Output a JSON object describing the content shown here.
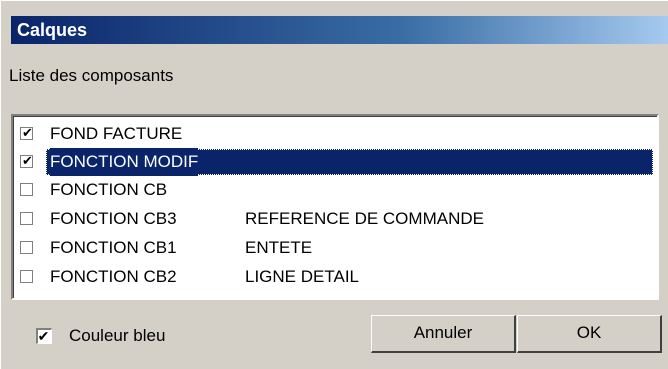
{
  "dialog": {
    "title": "Calques",
    "list_label": "Liste des composants"
  },
  "items": [
    {
      "checked": true,
      "label": "FOND FACTURE",
      "sub": ""
    },
    {
      "checked": true,
      "label": "FONCTION MODIF",
      "sub": "",
      "selected": true
    },
    {
      "checked": false,
      "label": "FONCTION CB",
      "sub": ""
    },
    {
      "checked": false,
      "label": "FONCTION CB3",
      "sub": "REFERENCE DE COMMANDE"
    },
    {
      "checked": false,
      "label": "FONCTION CB1",
      "sub": "ENTETE"
    },
    {
      "checked": false,
      "label": "FONCTION CB2",
      "sub": "LIGNE DETAIL"
    }
  ],
  "footer": {
    "blue_label": "Couleur bleu",
    "blue_checked": true,
    "cancel_label": "Annuler",
    "ok_label": "OK"
  },
  "colors": {
    "titlebar_start": "#0a246a",
    "titlebar_end": "#a6caf0",
    "selection": "#0a246a",
    "face": "#d4d0c8"
  }
}
